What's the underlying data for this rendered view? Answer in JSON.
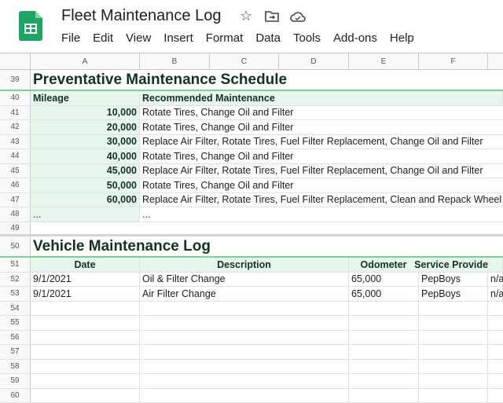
{
  "app": {
    "title": "Fleet Maintenance Log",
    "menu": [
      "File",
      "Edit",
      "View",
      "Insert",
      "Format",
      "Data",
      "Tools",
      "Add-ons",
      "Help"
    ],
    "accent": "#1e8e3e"
  },
  "columns": [
    "A",
    "B",
    "C",
    "D",
    "E",
    "F"
  ],
  "schedule": {
    "title": "Preventative Maintenance Schedule",
    "headers": [
      "Mileage",
      "Recommended Maintenance"
    ],
    "rows": [
      [
        "10,000",
        "Rotate Tires, Change Oil and Filter"
      ],
      [
        "20,000",
        "Rotate Tires, Change Oil and Filter"
      ],
      [
        "30,000",
        "Replace Air Filter, Rotate Tires, Fuel Filter Replacement, Change Oil and Filter"
      ],
      [
        "40,000",
        "Rotate Tires, Change Oil and Filter"
      ],
      [
        "45,000",
        "Replace Air Filter, Rotate Tires, Fuel Filter Replacement, Change Oil and Filter"
      ],
      [
        "50,000",
        "Rotate Tires, Change Oil and Filter"
      ],
      [
        "60,000",
        "Replace Air Filter, Rotate Tires, Fuel Filter Replacement, Clean and Repack Wheel B"
      ],
      [
        "...",
        "..."
      ]
    ]
  },
  "log": {
    "title": "Vehicle Maintenance Log",
    "headers": [
      "Date",
      "Description",
      "Odometer",
      "Service Provider"
    ],
    "rows": [
      [
        "9/1/2021",
        "Oil & Filter Change",
        "65,000",
        "PepBoys",
        "n/a"
      ],
      [
        "9/1/2021",
        "Air Filter Change",
        "65,000",
        "PepBoys",
        "n/a"
      ]
    ]
  },
  "row_numbers": [
    "39",
    "40",
    "41",
    "42",
    "43",
    "44",
    "45",
    "46",
    "47",
    "48",
    "49",
    "50",
    "51",
    "52",
    "53",
    "54",
    "55",
    "56",
    "57",
    "58",
    "59",
    "60"
  ]
}
